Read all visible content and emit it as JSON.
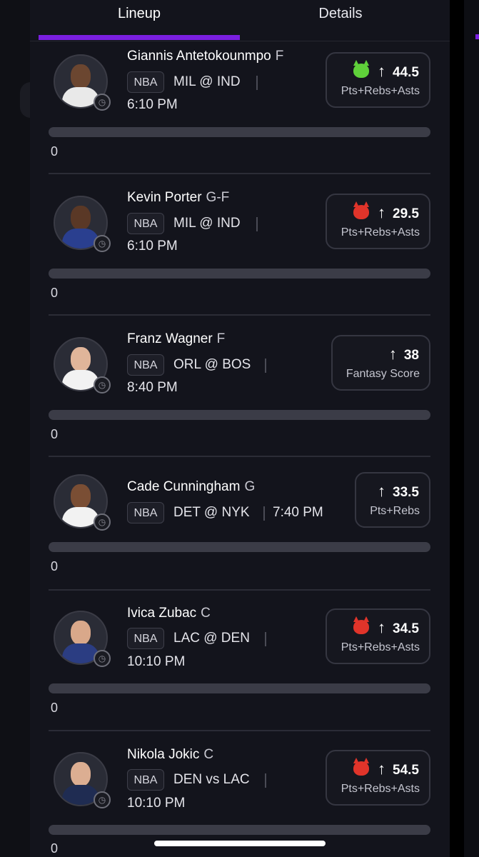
{
  "tabs": [
    {
      "label": "Lineup",
      "active": true
    },
    {
      "label": "Details",
      "active": false
    }
  ],
  "colors": {
    "accent": "#7a1fe0",
    "background": "#13141c",
    "card_border": "#353641",
    "progress_track": "#3b3c47"
  },
  "players": [
    {
      "name": "Giannis Antetokounmpo",
      "position": "F",
      "league": "NBA",
      "matchup": "MIL @ IND",
      "time": "6:10 PM",
      "line": "44.5",
      "stat": "Pts+Rebs+Asts",
      "badge_icon": "green-goblin-icon",
      "direction_icon": "arrow-up-icon",
      "progress_value": "0",
      "progress_fraction": 0
    },
    {
      "name": "Kevin Porter",
      "position": "G-F",
      "league": "NBA",
      "matchup": "MIL @ IND",
      "time": "6:10 PM",
      "line": "29.5",
      "stat": "Pts+Rebs+Asts",
      "badge_icon": "red-demon-icon",
      "direction_icon": "arrow-up-icon",
      "progress_value": "0",
      "progress_fraction": 0
    },
    {
      "name": "Franz Wagner",
      "position": "F",
      "league": "NBA",
      "matchup": "ORL @ BOS",
      "time": "8:40 PM",
      "line": "38",
      "stat": "Fantasy Score",
      "badge_icon": "",
      "direction_icon": "arrow-up-icon",
      "progress_value": "0",
      "progress_fraction": 0
    },
    {
      "name": "Cade Cunningham",
      "position": "G",
      "league": "NBA",
      "matchup": "DET @ NYK",
      "time": "7:40 PM",
      "line": "33.5",
      "stat": "Pts+Rebs",
      "badge_icon": "",
      "direction_icon": "arrow-up-icon",
      "progress_value": "0",
      "progress_fraction": 0
    },
    {
      "name": "Ivica Zubac",
      "position": "C",
      "league": "NBA",
      "matchup": "LAC @ DEN",
      "time": "10:10 PM",
      "line": "34.5",
      "stat": "Pts+Rebs+Asts",
      "badge_icon": "red-demon-icon",
      "direction_icon": "arrow-up-icon",
      "progress_value": "0",
      "progress_fraction": 0
    },
    {
      "name": "Nikola Jokic",
      "position": "C",
      "league": "NBA",
      "matchup": "DEN vs LAC",
      "time": "10:10 PM",
      "line": "54.5",
      "stat": "Pts+Rebs+Asts",
      "badge_icon": "red-demon-icon",
      "direction_icon": "arrow-up-icon",
      "progress_value": "0",
      "progress_fraction": 0
    }
  ]
}
